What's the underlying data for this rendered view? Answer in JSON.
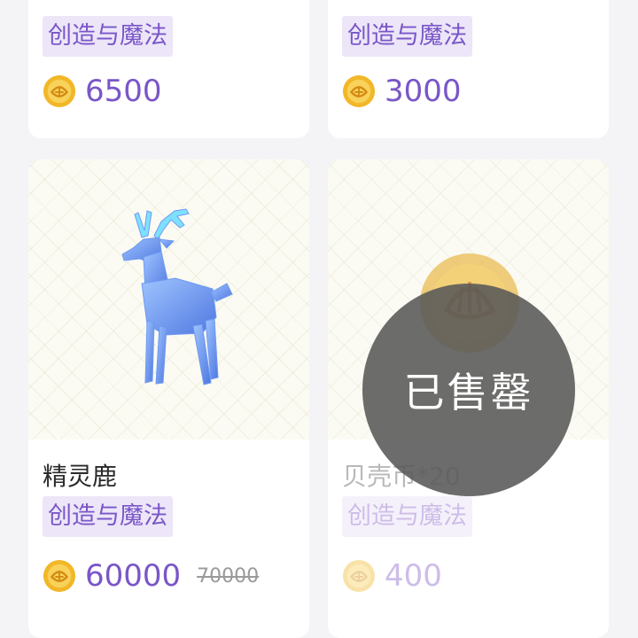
{
  "cards": [
    {
      "title": "",
      "tag": "创造与魔法",
      "price": "6500"
    },
    {
      "title": "",
      "tag": "创造与魔法",
      "price": "3000"
    },
    {
      "title": "精灵鹿",
      "tag": "创造与魔法",
      "price": "60000",
      "original_price": "70000",
      "image": "blue-deer"
    },
    {
      "title": "贝壳币*20",
      "tag": "创造与魔法",
      "price": "400",
      "image": "shell-coin",
      "sold_out": true
    }
  ],
  "sold_out_label": "已售罄",
  "colors": {
    "accent": "#7a56c8",
    "tag_bg": "#ece6f8",
    "coin": "#f2b728",
    "overlay": "#585858"
  },
  "icons": {
    "currency": "shell-coin-icon"
  }
}
